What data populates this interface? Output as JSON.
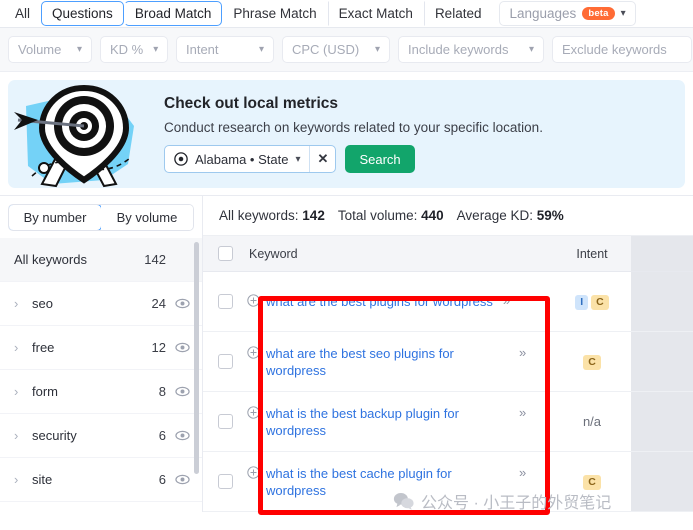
{
  "tabs": [
    {
      "label": "All",
      "selected": false
    },
    {
      "label": "Questions",
      "selected": true
    },
    {
      "label": "Broad Match",
      "selected": true
    },
    {
      "label": "Phrase Match",
      "selected": false
    },
    {
      "label": "Exact Match",
      "selected": false
    },
    {
      "label": "Related",
      "selected": false
    }
  ],
  "languages": {
    "label": "Languages",
    "badge": "beta",
    "caret": "chevron-down-icon"
  },
  "filters": [
    {
      "label": "Volume",
      "has_caret": true
    },
    {
      "label": "KD %",
      "has_caret": true
    },
    {
      "label": "Intent",
      "has_caret": true
    },
    {
      "label": "CPC (USD)",
      "has_caret": true
    },
    {
      "label": "Include keywords",
      "has_caret": true
    },
    {
      "label": "Exclude keywords",
      "has_caret": false
    }
  ],
  "banner": {
    "title": "Check out local metrics",
    "subtitle": "Conduct research on keywords related to your specific location.",
    "location_value": "Alabama • State",
    "location_icon": "location-pin-icon",
    "clear_label": "✕",
    "search_label": "Search",
    "accent_blue": "#e7f4fd",
    "search_green": "#12a56b"
  },
  "sidebar": {
    "toggle": [
      {
        "label": "By number",
        "selected": true
      },
      {
        "label": "By volume",
        "selected": false
      }
    ],
    "header_row": {
      "label": "All keywords",
      "count": "142"
    },
    "items": [
      {
        "label": "seo",
        "count": "24"
      },
      {
        "label": "free",
        "count": "12"
      },
      {
        "label": "form",
        "count": "8"
      },
      {
        "label": "security",
        "count": "6"
      },
      {
        "label": "site",
        "count": "6"
      }
    ]
  },
  "summary": {
    "all_keywords_label": "All keywords:",
    "all_keywords_value": "142",
    "total_volume_label": "Total volume:",
    "total_volume_value": "440",
    "average_kd_label": "Average KD:",
    "average_kd_value": "59%"
  },
  "table": {
    "columns": {
      "keyword": "Keyword",
      "intent": "Intent"
    },
    "rows": [
      {
        "keyword": "what are the best plugins for wordpress",
        "truncated": true,
        "chevron": "»",
        "intent": [
          "I",
          "C"
        ],
        "intent_na": ""
      },
      {
        "keyword": "what are the best seo plugins for wordpress",
        "truncated": false,
        "chevron": "»",
        "intent": [
          "C"
        ],
        "intent_na": ""
      },
      {
        "keyword": "what is the best backup plugin for wordpress",
        "truncated": false,
        "chevron": "»",
        "intent": [],
        "intent_na": "n/a"
      },
      {
        "keyword": "what is the best cache plugin for wordpress",
        "truncated": false,
        "chevron": "»",
        "intent": [
          "C"
        ],
        "intent_na": ""
      }
    ]
  },
  "annotation": {
    "color": "#ff0000"
  },
  "watermark": {
    "text": "公众号 · 小王子的外贸笔记",
    "icon": "wechat-icon"
  }
}
